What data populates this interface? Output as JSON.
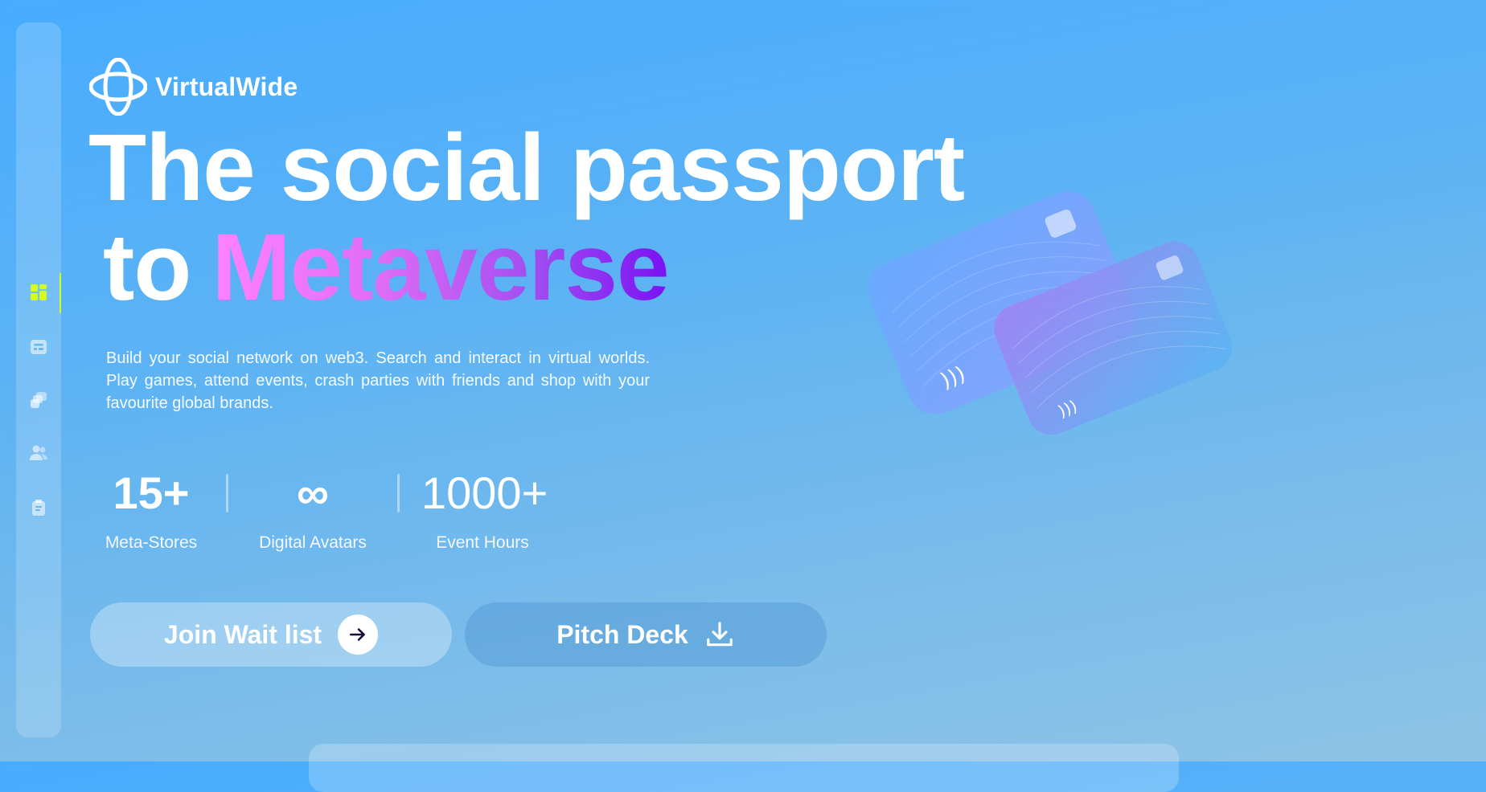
{
  "brand": {
    "name": "VirtualWide",
    "logo_icon": "orbit-logo-icon"
  },
  "sidebar": {
    "items": [
      {
        "name": "dashboard",
        "icon": "dashboard-grid-icon",
        "active": true
      },
      {
        "name": "id-card",
        "icon": "id-card-icon",
        "active": false
      },
      {
        "name": "gallery",
        "icon": "gallery-icon",
        "active": false
      },
      {
        "name": "users",
        "icon": "users-icon",
        "active": false
      },
      {
        "name": "clipboard",
        "icon": "clipboard-icon",
        "active": false
      }
    ]
  },
  "hero": {
    "line1": "The social passport",
    "line2_prefix": "to",
    "line2_highlight": "Metaverse",
    "description": "Build your social network on web3. Search and interact in virtual worlds. Play games, attend events, crash parties with friends and shop with your favourite global brands."
  },
  "stats": [
    {
      "value": "15+",
      "label": "Meta-Stores"
    },
    {
      "value": "∞",
      "label": "Digital Avatars"
    },
    {
      "value": "1000+",
      "label": "Event Hours"
    }
  ],
  "buttons": {
    "join": {
      "label": "Join Wait list",
      "icon": "arrow-right-icon"
    },
    "pitch": {
      "label": "Pitch Deck",
      "icon": "download-icon"
    }
  },
  "colors": {
    "accent": "#d4ff1e",
    "gradient_start": "#ff82ff",
    "gradient_end": "#7a12f2",
    "background": "#47acff"
  }
}
